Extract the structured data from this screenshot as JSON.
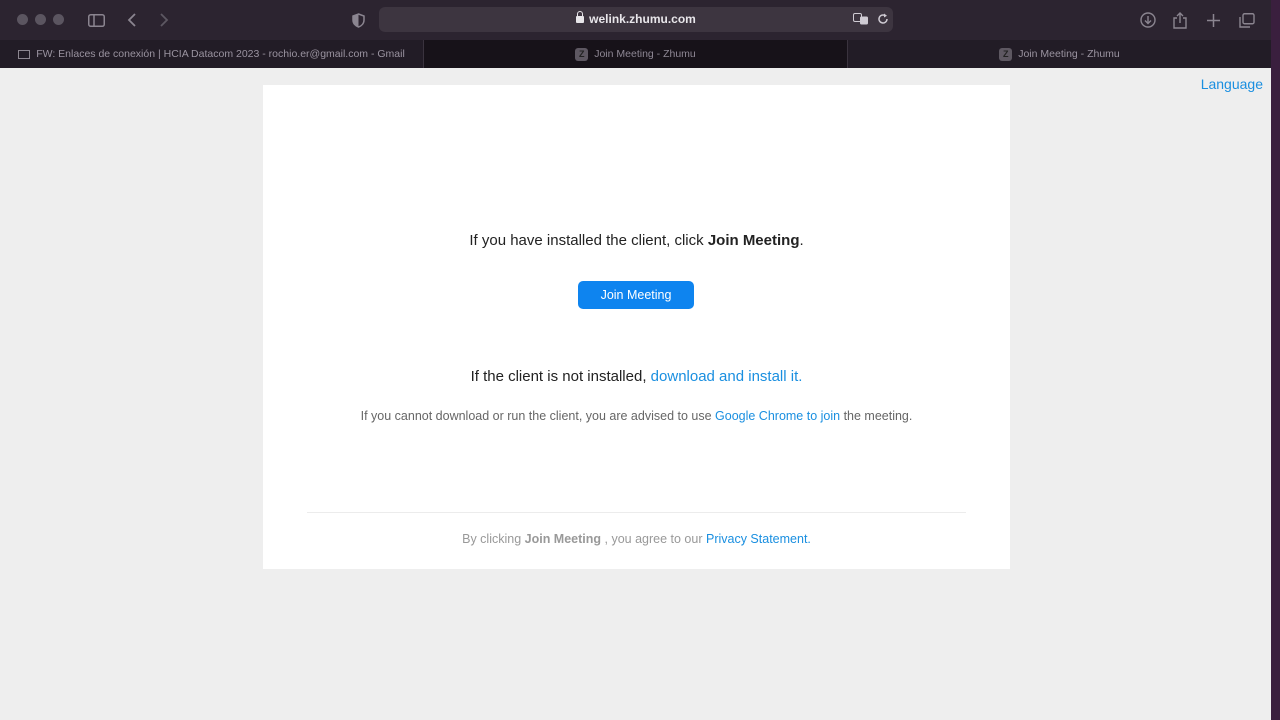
{
  "browser": {
    "address": "welink.zhumu.com",
    "tabs": [
      {
        "title": "FW: Enlaces de conexión | HCIA Datacom 2023 - rochio.er@gmail.com - Gmail"
      },
      {
        "title": "Join Meeting - Zhumu",
        "favicon": "Z"
      },
      {
        "title": "Join Meeting - Zhumu",
        "favicon": "Z"
      }
    ]
  },
  "page": {
    "language_link": "Language",
    "line1_pre": "If you have installed the client, click ",
    "line1_bold": "Join Meeting",
    "line1_post": ".",
    "join_button": "Join Meeting",
    "line2_pre": "If the client is not installed, ",
    "line2_link": "download and install it.",
    "line3_pre": "If you cannot download or run the client, you are advised to use ",
    "line3_link": "Google Chrome to join",
    "line3_post": " the meeting.",
    "footer_pre": "By clicking ",
    "footer_bold": "Join Meeting",
    "footer_mid": " , you agree to our ",
    "footer_link": "Privacy Statement."
  },
  "colors": {
    "accent": "#0e84ef",
    "link": "#1a8fe0"
  }
}
